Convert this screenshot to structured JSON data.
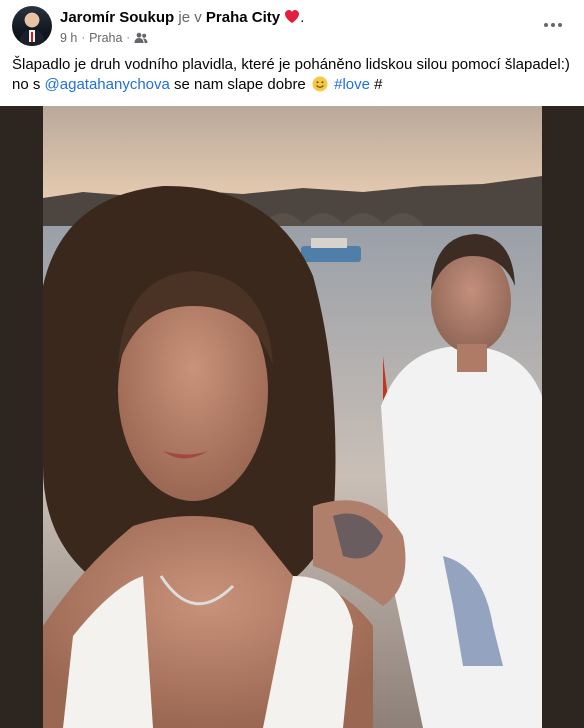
{
  "post": {
    "author": "Jaromír Soukup",
    "is_in": "je v",
    "place": "Praha City",
    "period": ".",
    "time": "9 h",
    "separator": "·",
    "location": "Praha",
    "audience_icon": "friends-icon",
    "more_icon": "more-options-icon"
  },
  "caption": {
    "text_before": "Šlapadlo je druh vodního plavidla, které je poháněno lidskou silou pomocí šlapadel:) no s ",
    "mention": "@agatahanychova",
    "text_middle": " se nam slape dobre ",
    "emoji": "smiley-emoji-icon",
    "hashtag": "#love",
    "trailing": " #"
  },
  "colors": {
    "link": "#216fdb",
    "secondary_text": "#65676b",
    "heart": "#e41e3f"
  }
}
